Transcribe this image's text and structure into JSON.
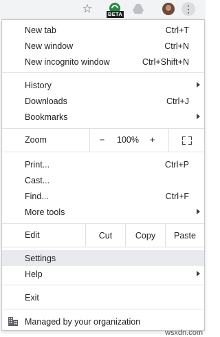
{
  "toolbar": {
    "icons": [
      "star-icon",
      "beta-extension-icon",
      "drive-icon",
      "avatar",
      "kebab-menu-icon"
    ],
    "beta_label": "BETA",
    "accent": "#1e8e3e"
  },
  "menu": {
    "new_tab": {
      "label": "New tab",
      "shortcut": "Ctrl+T"
    },
    "new_window": {
      "label": "New window",
      "shortcut": "Ctrl+N"
    },
    "new_incognito": {
      "label": "New incognito window",
      "shortcut": "Ctrl+Shift+N"
    },
    "history": {
      "label": "History"
    },
    "downloads": {
      "label": "Downloads",
      "shortcut": "Ctrl+J"
    },
    "bookmarks": {
      "label": "Bookmarks"
    },
    "zoom": {
      "label": "Zoom",
      "minus": "−",
      "value": "100%",
      "plus": "+"
    },
    "print": {
      "label": "Print...",
      "shortcut": "Ctrl+P"
    },
    "cast": {
      "label": "Cast..."
    },
    "find": {
      "label": "Find...",
      "shortcut": "Ctrl+F"
    },
    "more_tools": {
      "label": "More tools"
    },
    "edit": {
      "label": "Edit",
      "cut": "Cut",
      "copy": "Copy",
      "paste": "Paste"
    },
    "settings": {
      "label": "Settings"
    },
    "help": {
      "label": "Help"
    },
    "exit": {
      "label": "Exit"
    },
    "managed": {
      "label": "Managed by your organization"
    }
  },
  "watermark": "wsxdn.com"
}
